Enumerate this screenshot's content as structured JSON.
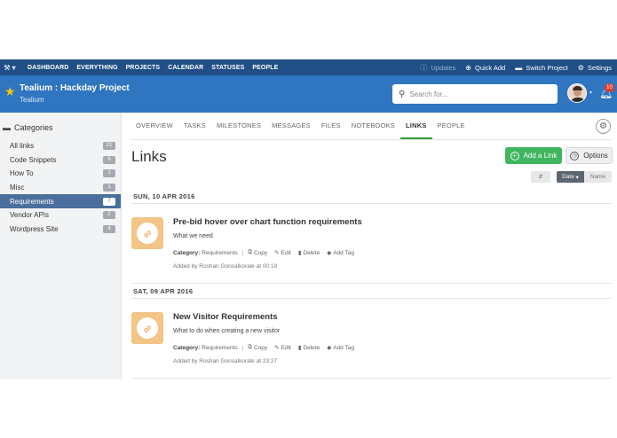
{
  "topnav": {
    "logo_icon": "tools-icon",
    "links": [
      "DASHBOARD",
      "EVERYTHING",
      "PROJECTS",
      "CALENDAR",
      "STATUSES",
      "PEOPLE"
    ],
    "updates_label": "Updates",
    "quick_add_label": "Quick Add",
    "switch_project_label": "Switch Project",
    "settings_label": "Settings"
  },
  "project": {
    "title": "Tealium : Hackday Project",
    "subtitle": "Tealium"
  },
  "search": {
    "placeholder": "Search for..."
  },
  "notifications": {
    "count": "10"
  },
  "sidebar": {
    "heading": "Categories",
    "items": [
      {
        "label": "All links",
        "count": "21"
      },
      {
        "label": "Code Snippets",
        "count": "6"
      },
      {
        "label": "How To",
        "count": "1"
      },
      {
        "label": "Misc",
        "count": "1"
      },
      {
        "label": "Requirements",
        "count": "7"
      },
      {
        "label": "Vendor APIs",
        "count": "2"
      },
      {
        "label": "Wordpress Site",
        "count": "4"
      }
    ]
  },
  "tabs": [
    "OVERVIEW",
    "TASKS",
    "MILESTONES",
    "MESSAGES",
    "FILES",
    "NOTEBOOKS",
    "LINKS",
    "PEOPLE"
  ],
  "main": {
    "title": "Links",
    "add_link_label": "Add a Link",
    "options_label": "Options",
    "sort_dir_label": "⇵",
    "sort_date_label": "Date",
    "sort_name_label": "Name"
  },
  "groups": [
    {
      "date": "SUN, 10 APR 2016",
      "links": [
        {
          "title": "Pre-bid hover over chart function requirements",
          "description": "What we need",
          "category_label": "Category:",
          "category": "Requirements",
          "copy": "Copy",
          "edit": "Edit",
          "delete": "Delete",
          "add_tag": "Add Tag",
          "added": "Added by Roshan Gonsalkorale at 00:18"
        }
      ]
    },
    {
      "date": "SAT, 09 APR 2016",
      "links": [
        {
          "title": "New Visitor Requirements",
          "description": "What to do when creating a new visitor",
          "category_label": "Category:",
          "category": "Requirements",
          "copy": "Copy",
          "edit": "Edit",
          "delete": "Delete",
          "add_tag": "Add Tag",
          "added": "Added by Roshan Gonsalkorale at 23:27"
        }
      ]
    }
  ],
  "colors": {
    "topnav": "#1f4f86",
    "header": "#2f75c0",
    "accent_green": "#3fb55f",
    "active_sidebar": "#4a6f9c",
    "link_icon_bg": "#f3c586"
  }
}
